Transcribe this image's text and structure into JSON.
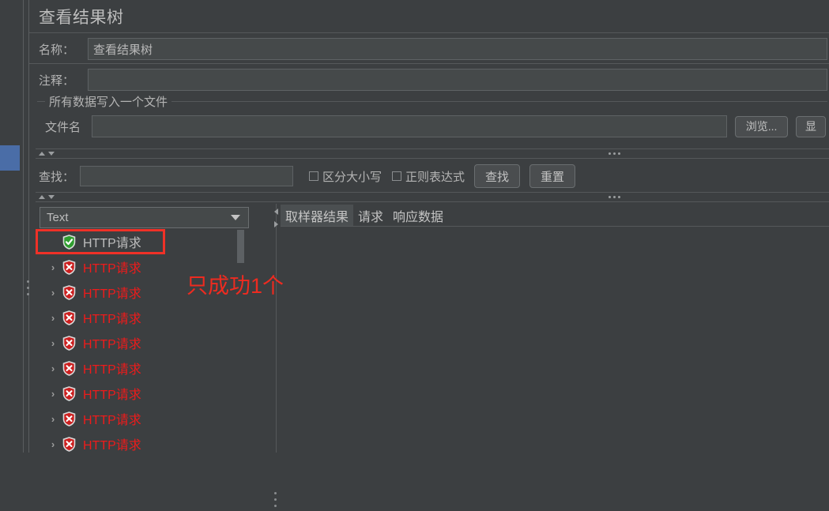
{
  "window": {
    "title": "查看结果树"
  },
  "form": {
    "name_label": "名称：",
    "name_value": "查看结果树",
    "comment_label": "注释：",
    "comment_value": "",
    "group_title": "所有数据写入一个文件",
    "filename_label": "文件名",
    "filename_value": "",
    "browse_button": "浏览...",
    "extra_button": "显"
  },
  "search": {
    "label": "查找：",
    "value": "",
    "case_sensitive_label": "区分大小写",
    "case_sensitive_checked": false,
    "regex_label": "正则表达式",
    "regex_checked": false,
    "find_button": "查找",
    "reset_button": "重置"
  },
  "renderer": {
    "selected": "Text"
  },
  "tabs": [
    {
      "label": "取样器结果",
      "active": true
    },
    {
      "label": "请求",
      "active": false
    },
    {
      "label": "响应数据",
      "active": false
    }
  ],
  "tree": {
    "items": [
      {
        "label": "HTTP请求",
        "status": "success",
        "expandable": false,
        "highlighted": true
      },
      {
        "label": "HTTP请求",
        "status": "error",
        "expandable": true,
        "highlighted": false
      },
      {
        "label": "HTTP请求",
        "status": "error",
        "expandable": true,
        "highlighted": false
      },
      {
        "label": "HTTP请求",
        "status": "error",
        "expandable": true,
        "highlighted": false
      },
      {
        "label": "HTTP请求",
        "status": "error",
        "expandable": true,
        "highlighted": false
      },
      {
        "label": "HTTP请求",
        "status": "error",
        "expandable": true,
        "highlighted": false
      },
      {
        "label": "HTTP请求",
        "status": "error",
        "expandable": true,
        "highlighted": false
      },
      {
        "label": "HTTP请求",
        "status": "error",
        "expandable": true,
        "highlighted": false
      },
      {
        "label": "HTTP请求",
        "status": "error",
        "expandable": true,
        "highlighted": false
      }
    ],
    "expand_arrow_glyph": "›"
  },
  "annotation": {
    "text": "只成功1个",
    "color": "#ee2b20"
  },
  "colors": {
    "background": "#3c3f41",
    "field_background": "#45494a",
    "border": "#5e6264",
    "text": "#b8b8b8",
    "error_red": "#ee1b1b",
    "success_green": "#3fa63f",
    "accent_blue": "#4a6da7",
    "annotation_red": "#f03127"
  }
}
